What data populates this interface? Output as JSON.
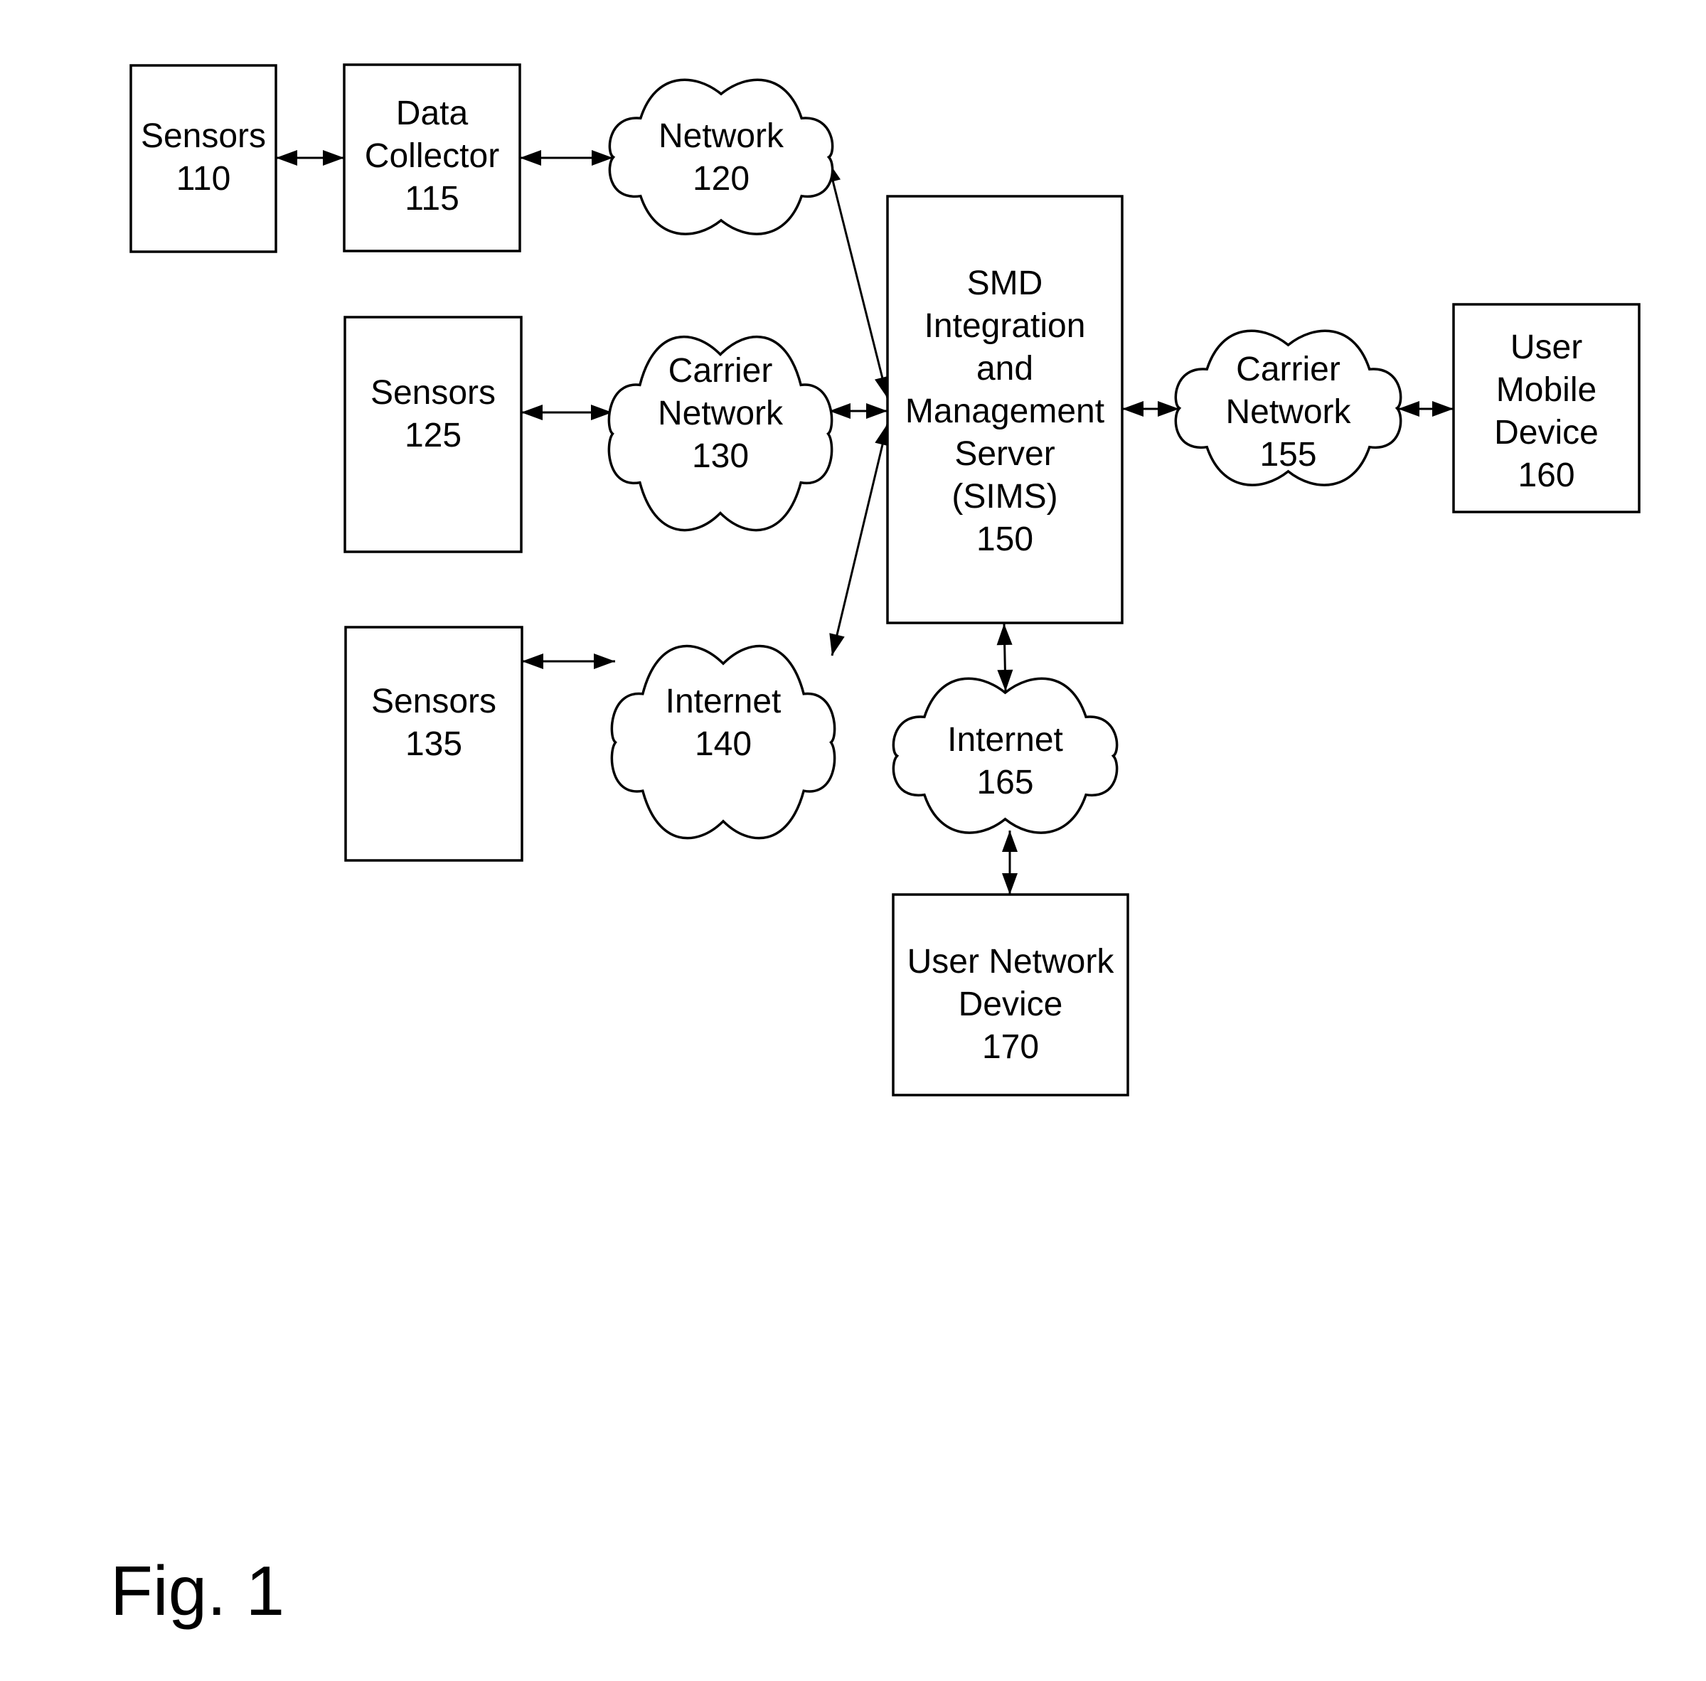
{
  "figure": {
    "label": "Fig. 1"
  },
  "nodes": {
    "sensors_110": {
      "shape": "box",
      "lines": [
        "Sensors",
        "110"
      ]
    },
    "data_collector_115": {
      "shape": "box",
      "lines": [
        "Data",
        "Collector",
        "115"
      ]
    },
    "network_120": {
      "shape": "cloud",
      "lines": [
        "Network",
        "120"
      ]
    },
    "sensors_125": {
      "shape": "box",
      "lines": [
        "Sensors",
        "125"
      ]
    },
    "carrier_network_130": {
      "shape": "cloud",
      "lines": [
        "Carrier",
        "Network",
        "130"
      ]
    },
    "sensors_135": {
      "shape": "box",
      "lines": [
        "Sensors",
        "135"
      ]
    },
    "internet_140": {
      "shape": "cloud",
      "lines": [
        "Internet",
        "140"
      ]
    },
    "sims_150": {
      "shape": "box",
      "lines": [
        "SMD",
        "Integration",
        "and",
        "Management",
        "Server",
        "(SIMS)",
        "150"
      ]
    },
    "carrier_network_155": {
      "shape": "cloud",
      "lines": [
        "Carrier",
        "Network",
        "155"
      ]
    },
    "user_mobile_device_160": {
      "shape": "box",
      "lines": [
        "User",
        "Mobile",
        "Device",
        "160"
      ]
    },
    "internet_165": {
      "shape": "cloud",
      "lines": [
        "Internet",
        "165"
      ]
    },
    "user_network_device_170": {
      "shape": "box",
      "lines": [
        "User Network",
        "Device",
        "170"
      ]
    }
  },
  "edges": [
    {
      "from": "sensors_110",
      "to": "data_collector_115",
      "direction": "bidirectional"
    },
    {
      "from": "data_collector_115",
      "to": "network_120",
      "direction": "bidirectional"
    },
    {
      "from": "network_120",
      "to": "sims_150",
      "direction": "bidirectional"
    },
    {
      "from": "sensors_125",
      "to": "carrier_network_130",
      "direction": "bidirectional"
    },
    {
      "from": "carrier_network_130",
      "to": "sims_150",
      "direction": "bidirectional"
    },
    {
      "from": "sensors_135",
      "to": "internet_140",
      "direction": "bidirectional"
    },
    {
      "from": "internet_140",
      "to": "sims_150",
      "direction": "bidirectional"
    },
    {
      "from": "sims_150",
      "to": "carrier_network_155",
      "direction": "bidirectional"
    },
    {
      "from": "carrier_network_155",
      "to": "user_mobile_device_160",
      "direction": "bidirectional"
    },
    {
      "from": "sims_150",
      "to": "internet_165",
      "direction": "bidirectional"
    },
    {
      "from": "internet_165",
      "to": "user_network_device_170",
      "direction": "bidirectional"
    }
  ]
}
